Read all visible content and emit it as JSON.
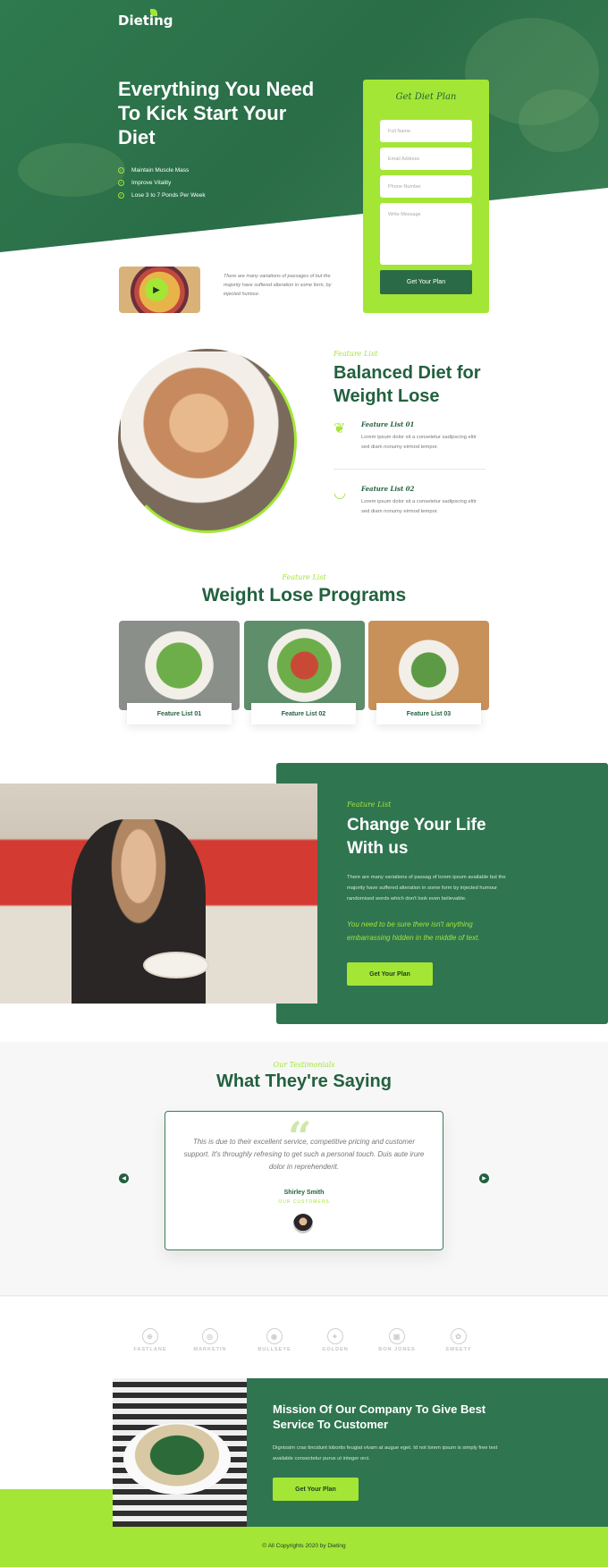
{
  "brand": {
    "logo_text": "Dieting",
    "accent": "#a3e635",
    "primary": "#23613f",
    "card": "#2f7550"
  },
  "hero": {
    "title": "Everything You Need To Kick Start Your Diet",
    "checks": [
      "Maintain Muscle Mass",
      "Improve Vitality",
      "Lose 3 to 7 Ponds Per Week"
    ]
  },
  "form": {
    "title": "Get Diet Plan",
    "fields": [
      "Full Name",
      "Email Address",
      "Phone Number",
      "Write Message"
    ],
    "submit_label": "Get Your Plan"
  },
  "video": {
    "text": "There are many variations of passages of but the majority have suffered alteration in some form, by injected humour."
  },
  "feature": {
    "subtitle": "Feature List",
    "title": "Balanced Diet for Weight Lose",
    "items": [
      {
        "title": "Feature List 01",
        "text": "Lorem ipsum dolor sit a consetetur sadipscing elitr sed diam nonumy eirmod tempor."
      },
      {
        "title": "Feature List 02",
        "text": "Lorem ipsum dolor sit a consetetur sadipscing elitr sed diam nonumy eirmod tempor."
      }
    ]
  },
  "programs": {
    "subtitle": "Feature List",
    "title": "Weight Lose Programs",
    "items": [
      "Feature List 01",
      "Feature List 02",
      "Feature List 03"
    ]
  },
  "life": {
    "subtitle": "Feature List",
    "title": "Change Your Life With us",
    "text": "There are many variations of passag of lorem ipsum available but the majority have suffered alteration in some form by injected humour randomised words which don't look even believable.",
    "italic": "You need to be sure there isn't anything embarrassing hidden in the middle of text.",
    "button_label": "Get Your Plan"
  },
  "testimonials": {
    "subtitle": "Our Testimonials",
    "title": "What They're Saying",
    "quote": "This is due to their excellent service, competitive pricing and customer support. It's throughly refresing to get such a personal touch. Duis aute irure dolor in reprehenderit.",
    "name": "Shirley Smith",
    "role": "OUR CUSTOMERS"
  },
  "logos": [
    "FASTLANE",
    "MARKETIN",
    "BULLSEYE",
    "GOLDEN",
    "BON JONES",
    "SWEETY"
  ],
  "mission": {
    "title": "Mission Of Our Company To Give Best Service To Customer",
    "text": "Dignissim cras tincidunt lobortis feugiat vivam at augue eget. Id not lorem ipsum is simply free text available consectetur purus ut integer orci.",
    "button_label": "Get Your Plan"
  },
  "footer": {
    "copyright": "© All Copyrights 2020 by Dieting"
  }
}
